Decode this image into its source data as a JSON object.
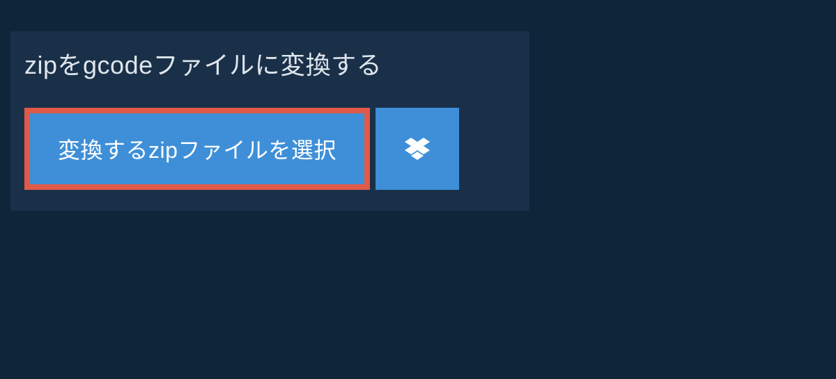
{
  "heading": {
    "text": "zipをgcodeファイルに変換する"
  },
  "buttons": {
    "select_file_label": "変換するzipファイルを選択"
  },
  "icons": {
    "dropbox": "dropbox-icon"
  },
  "colors": {
    "background_outer": "#0f2539",
    "background_panel": "#1a3049",
    "button_primary": "#3e8fd8",
    "button_border": "#e05a47",
    "text_heading": "#dfe6ec",
    "text_button": "#ffffff"
  }
}
